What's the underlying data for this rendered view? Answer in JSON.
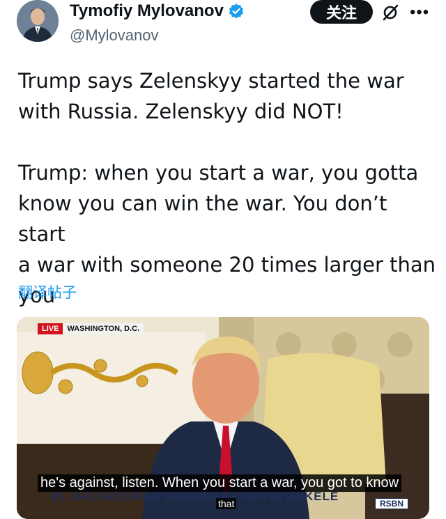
{
  "user": {
    "display_name": "Tymofiy Mylovanov",
    "handle": "@Mylovanov",
    "avatar_icon": "person-avatar-icon",
    "verified_icon": "verified-badge-icon"
  },
  "actions": {
    "follow_label": "关注",
    "grok_icon": "grok-icon",
    "more_icon": "more-options-icon"
  },
  "tweet": {
    "text": "Trump says Zelenskyy started the war\nwith Russia. Zelenskyy did NOT!\n\nTrump: when you start a war, you gotta\nknow you can win the war. You don’t start\na war with someone 20 times larger than\nyou",
    "translate_label": "翻译帖子"
  },
  "media": {
    "live_label": "LIVE",
    "location_label": "WASHINGTON, D.C.",
    "subtitle_line1": "he's against, listen. When you start a war, you got to know",
    "subtitle_line2": "that",
    "lower_third": "EL SALVADORAN PRESIDENT NAYIB BUKELE",
    "network_logo": "RSBN"
  },
  "colors": {
    "link_blue": "#1d9bf0",
    "text_primary": "#0f1419",
    "text_secondary": "#536471",
    "live_red": "#d3131c"
  }
}
